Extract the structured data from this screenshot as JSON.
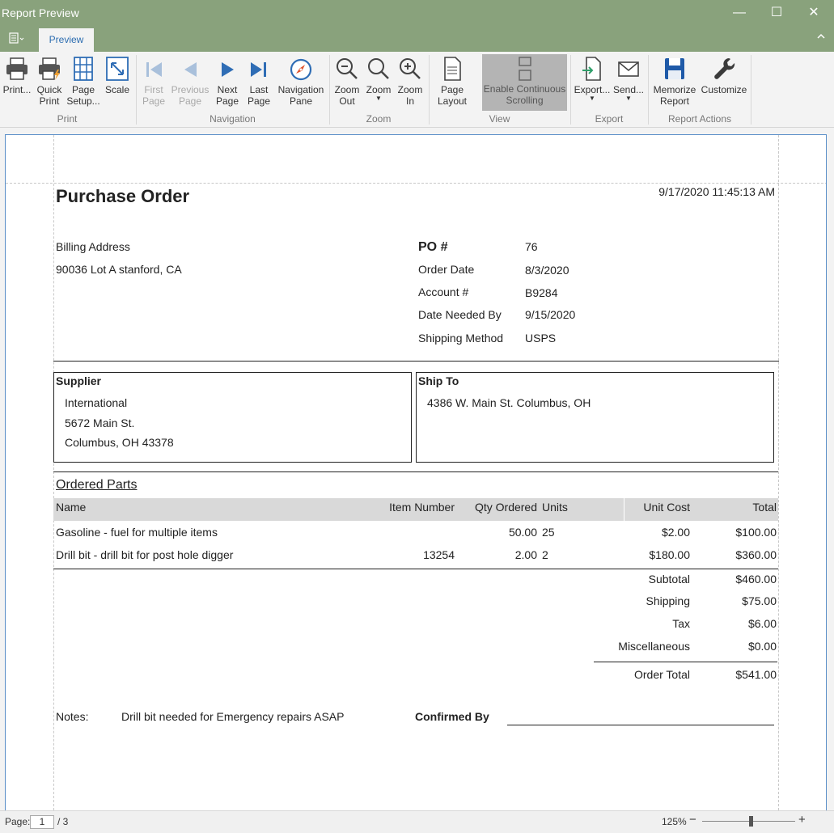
{
  "window": {
    "title": "Report Preview",
    "minimize_glyph": "—",
    "maximize_glyph": "☐",
    "close_glyph": "✕"
  },
  "ribbon_tabs": {
    "active": "Preview"
  },
  "ribbon": {
    "buttons": {
      "print": "Print...",
      "quick_print": [
        "Quick",
        "Print"
      ],
      "page_setup": [
        "Page",
        "Setup..."
      ],
      "scale": "Scale",
      "first_page": [
        "First",
        "Page"
      ],
      "previous_page": [
        "Previous",
        "Page"
      ],
      "next_page": [
        "Next",
        "Page"
      ],
      "last_page": [
        "Last",
        "Page"
      ],
      "navigation_pane": [
        "Navigation",
        "Pane"
      ],
      "zoom_out": [
        "Zoom",
        "Out"
      ],
      "zoom": "Zoom",
      "zoom_in": [
        "Zoom",
        "In"
      ],
      "page_layout": [
        "Page",
        "Layout"
      ],
      "continuous_scrolling": [
        "Enable Continuous",
        "Scrolling"
      ],
      "export": "Export...",
      "send": "Send...",
      "memorize_report": [
        "Memorize",
        "Report"
      ],
      "customize": "Customize"
    },
    "groups": {
      "print": "Print",
      "navigation": "Navigation",
      "zoom": "Zoom",
      "view": "View",
      "export": "Export",
      "report_actions": "Report Actions"
    },
    "accent": "#2f6db5",
    "titlebar_color": "#89a27c"
  },
  "report": {
    "title": "Purchase Order",
    "timestamp": "9/17/2020 11:45:13 AM",
    "billing": {
      "label": "Billing Address",
      "address": "90036 Lot A stanford, CA"
    },
    "details": {
      "po_label": "PO #",
      "po_value": "76",
      "order_date_label": "Order Date",
      "order_date_value": "8/3/2020",
      "account_label": "Account #",
      "account_value": "B9284",
      "date_needed_label": "Date Needed By",
      "date_needed_value": "9/15/2020",
      "shipping_method_label": "Shipping Method",
      "shipping_method_value": "USPS"
    },
    "supplier": {
      "label": "Supplier",
      "lines": [
        "International",
        "5672 Main St.",
        "Columbus, OH 43378"
      ]
    },
    "ship_to": {
      "label": "Ship To",
      "lines": [
        "4386 W. Main St. Columbus, OH"
      ]
    },
    "ordered_parts": {
      "heading": "Ordered Parts",
      "columns": {
        "name": "Name",
        "item_number": "Item Number",
        "qty_ordered": "Qty Ordered",
        "units": "Units",
        "unit_cost": "Unit Cost",
        "total": "Total"
      },
      "rows": [
        {
          "name": "Gasoline - fuel for multiple items",
          "item_number": "",
          "qty": "50.00",
          "units": "25",
          "unit_cost": "$2.00",
          "total": "$100.00"
        },
        {
          "name": "Drill bit - drill bit for post hole digger",
          "item_number": "13254",
          "qty": "2.00",
          "units": "2",
          "unit_cost": "$180.00",
          "total": "$360.00"
        }
      ]
    },
    "totals": {
      "subtotal_label": "Subtotal",
      "subtotal": "$460.00",
      "shipping_label": "Shipping",
      "shipping": "$75.00",
      "tax_label": "Tax",
      "tax": "$6.00",
      "misc_label": "Miscellaneous",
      "misc": "$0.00",
      "order_total_label": "Order Total",
      "order_total": "$541.00"
    },
    "notes": {
      "label": "Notes:",
      "text": "Drill bit needed for Emergency repairs ASAP",
      "confirmed_by_label": "Confirmed By"
    }
  },
  "status": {
    "page_label": "Page:",
    "current_page": "1",
    "total_pages": "/ 3",
    "zoom_level": "125%",
    "zoom_minus": "−",
    "zoom_plus": "+"
  }
}
